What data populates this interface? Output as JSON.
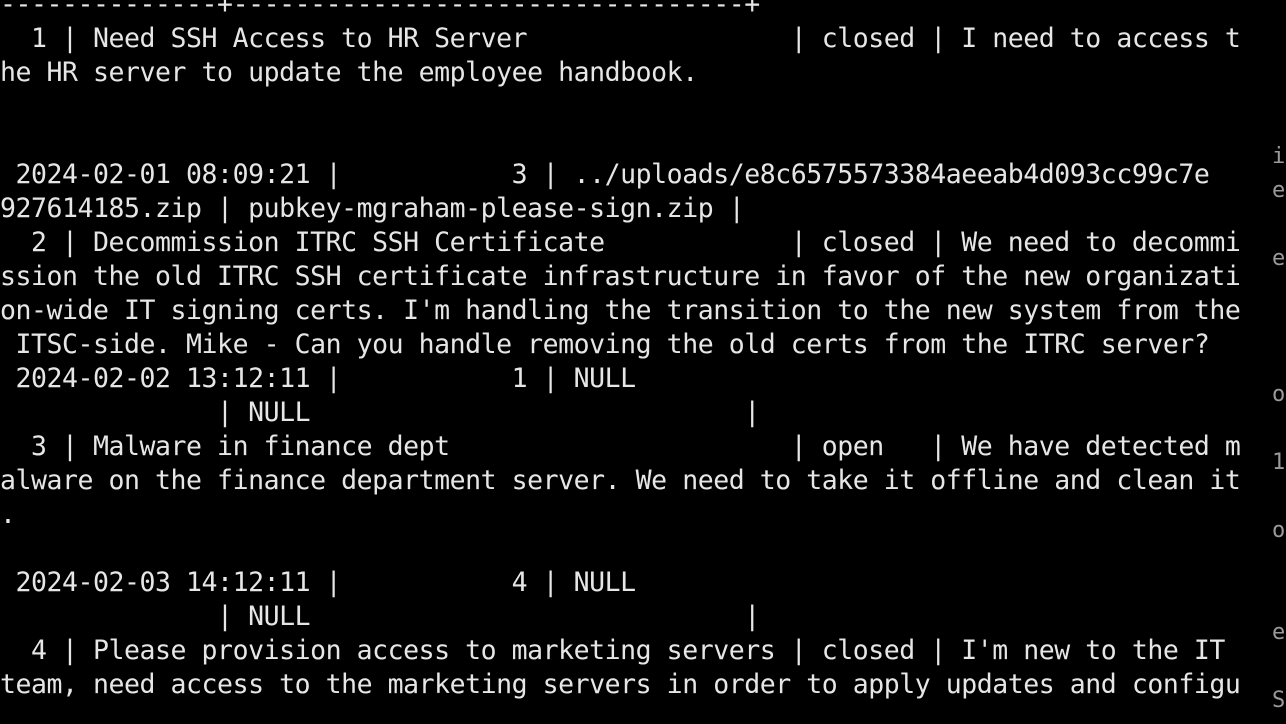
{
  "terminal": {
    "lines": [
      "--------------+---------------------------------+",
      "  1 | Need SSH Access to HR Server                 | closed | I need to access t",
      "he HR server to update the employee handbook.",
      "",
      "",
      " 2024-02-01 08:09:21 |           3 | ../uploads/e8c6575573384aeeab4d093cc99c7e",
      "927614185.zip | pubkey-mgraham-please-sign.zip |",
      "  2 | Decommission ITRC SSH Certificate            | closed | We need to decommi",
      "ssion the old ITRC SSH certificate infrastructure in favor of the new organizati",
      "on-wide IT signing certs. I'm handling the transition to the new system from the",
      " ITSC-side. Mike - Can you handle removing the old certs from the ITRC server?",
      " 2024-02-02 13:12:11 |           1 | NULL",
      "              | NULL                            |",
      "  3 | Malware in finance dept                      | open   | We have detected m",
      "alware on the finance department server. We need to take it offline and clean it",
      ".",
      "",
      " 2024-02-03 14:12:11 |           4 | NULL",
      "              | NULL                            |",
      "  4 | Please provision access to marketing servers | closed | I'm new to the IT ",
      "team, need access to the marketing servers in order to apply updates and configu"
    ]
  },
  "side_pane": {
    "glyphs": [
      "i",
      "e",
      "e",
      "o",
      "1",
      "o",
      "e",
      "S"
    ]
  }
}
